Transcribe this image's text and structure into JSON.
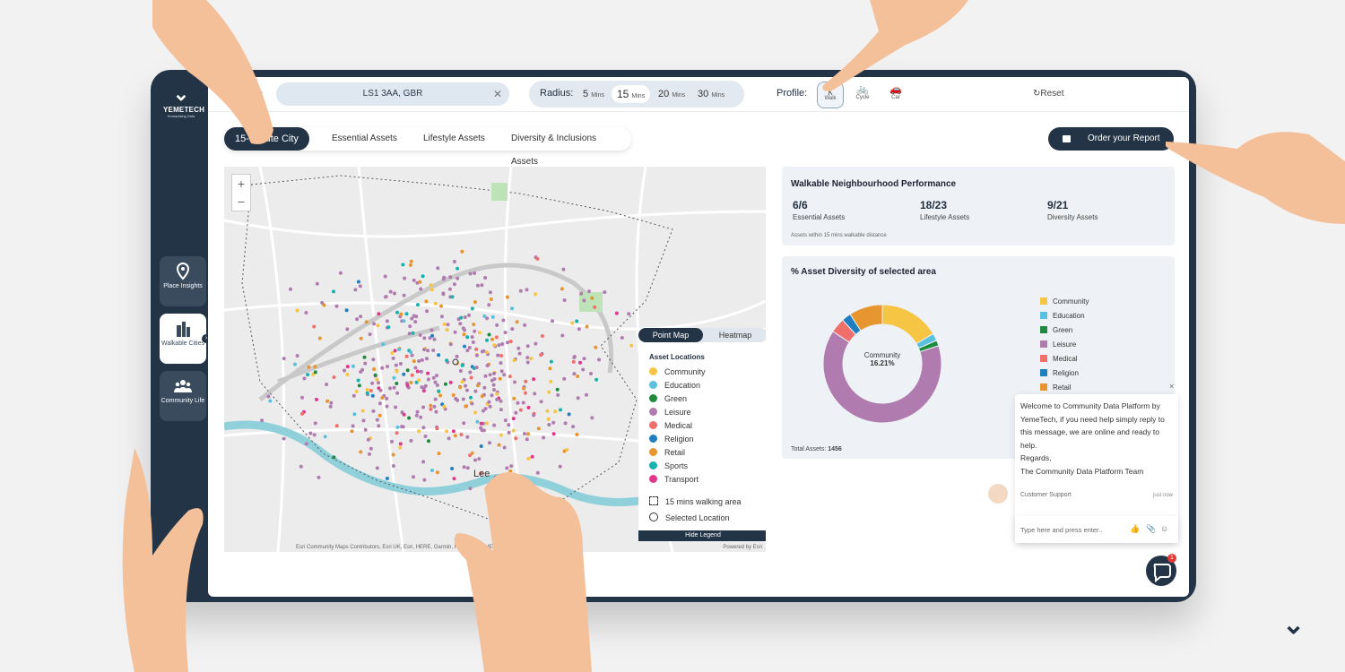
{
  "brand": {
    "name": "YEMETECH",
    "tagline": "Humanising Data"
  },
  "nav": [
    {
      "label": "Place Insights",
      "icon": "location-pin-icon"
    },
    {
      "label": "Walkable Cities",
      "icon": "buildings-icon",
      "active": true
    },
    {
      "label": "Community Life",
      "icon": "people-icon"
    }
  ],
  "topbar": {
    "address_label": "s:",
    "address_value": "LS1 3AA, GBR",
    "radius_label": "Radius:",
    "radius_options": [
      {
        "value": "5",
        "unit": "Mins"
      },
      {
        "value": "15",
        "unit": "Mins",
        "selected": true
      },
      {
        "value": "20",
        "unit": "Mins"
      },
      {
        "value": "30",
        "unit": "Mins"
      }
    ],
    "profile_label": "Profile:",
    "profiles": [
      {
        "label": "Walk",
        "glyph": "🚶",
        "selected": true
      },
      {
        "label": "Cycle",
        "glyph": "🚲"
      },
      {
        "label": "Car",
        "glyph": "🚗"
      }
    ],
    "reset_label": "↻Reset"
  },
  "tabs": [
    "15-Minute City",
    "Essential Assets",
    "Lifestyle Assets",
    "Diversity & Inclusions Assets"
  ],
  "order_button": "Order your Report",
  "map": {
    "toggle": [
      "Point Map",
      "Heatmap"
    ],
    "legend_title": "Asset Locations",
    "legend": [
      {
        "label": "Community",
        "color": "#f6c544"
      },
      {
        "label": "Education",
        "color": "#5bc0de"
      },
      {
        "label": "Green",
        "color": "#1e8a3e"
      },
      {
        "label": "Leisure",
        "color": "#b07cb0"
      },
      {
        "label": "Medical",
        "color": "#ef6f6c"
      },
      {
        "label": "Religion",
        "color": "#1f7fc0"
      },
      {
        "label": "Retail",
        "color": "#e6952f"
      },
      {
        "label": "Sports",
        "color": "#18b1ad"
      },
      {
        "label": "Transport",
        "color": "#e0398b"
      }
    ],
    "walking_area_label": "15 mins walking area",
    "selected_location_label": "Selected Location",
    "hide_legend": "Hide Legend",
    "attribution": "Esri Community Maps Contributors, Esri UK, Esri, HERE, Garmin, Foursquare, METI/NASA, USGS",
    "powered_by": "Powered by Esri",
    "place_label": "Lee"
  },
  "performance": {
    "title": "Walkable Neighbourhood Performance",
    "stats": [
      {
        "value": "6/6",
        "label": "Essential Assets"
      },
      {
        "value": "18/23",
        "label": "Lifestyle Assets"
      },
      {
        "value": "9/21",
        "label": "Diversity Assets"
      }
    ],
    "note": "Assets within 15 mins walkable distance"
  },
  "diversity": {
    "title": "% Asset Diversity of selected area",
    "center_label": "Community",
    "center_value": "16.21%",
    "total_label": "Total Assets:",
    "total_value": "1456"
  },
  "chart_data": {
    "type": "pie",
    "title": "% Asset Diversity of selected area",
    "categories": [
      "Community",
      "Education",
      "Green",
      "Leisure",
      "Medical",
      "Religion",
      "Retail"
    ],
    "values": [
      16.21,
      2.0,
      1.5,
      63.0,
      4.0,
      2.5,
      9.0
    ],
    "colors": [
      "#f6c544",
      "#5bc0de",
      "#1e8a3e",
      "#b07cb0",
      "#ef6f6c",
      "#1f7fc0",
      "#e6952f"
    ]
  },
  "chat": {
    "message_lines": [
      "Welcome to Community Data Platform by",
      "YemeTech, if you need help simply reply to",
      "this message, we are online and ready to",
      "help.",
      "Regards,",
      "The Community Data Platform Team"
    ],
    "sender": "Customer Support",
    "time": "just now",
    "input_placeholder": "Type here and press enter..",
    "badge": "1",
    "close": "×"
  }
}
